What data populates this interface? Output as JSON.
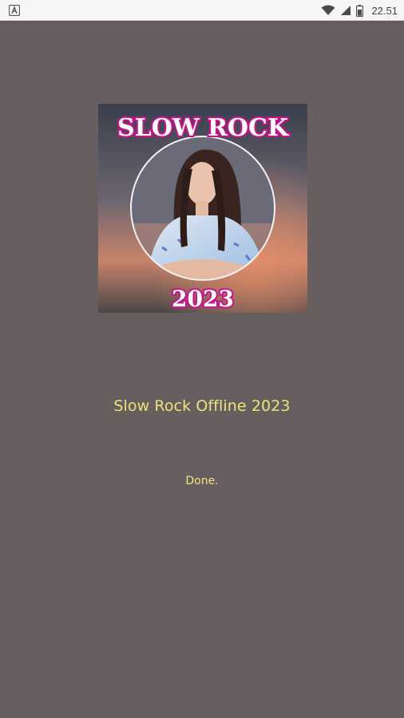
{
  "status_bar": {
    "time": "22.51",
    "icons": [
      "app-notification-icon",
      "wifi-icon",
      "cell-signal-icon",
      "battery-icon"
    ]
  },
  "cover_art": {
    "headline": "SLOW ROCK",
    "year": "2023",
    "headline_color": "#ffffff",
    "outline_color": "#c8138d"
  },
  "app": {
    "title": "Slow Rock Offline 2023",
    "status": "Done."
  },
  "colors": {
    "background": "#675e60",
    "text_accent": "#efe27a"
  }
}
